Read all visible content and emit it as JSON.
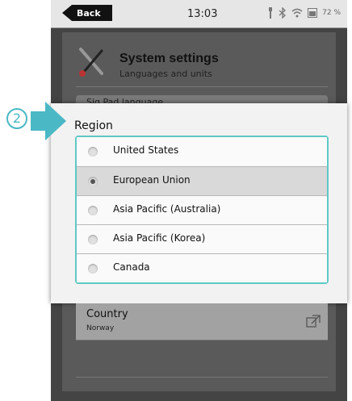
{
  "statusbar": {
    "back_label": "Back",
    "time": "13:03",
    "battery": "72 %",
    "icons": [
      "usb-icon",
      "bluetooth-icon",
      "wifi-icon",
      "battery-icon"
    ]
  },
  "header": {
    "title": "System settings",
    "subtitle": "Languages and units"
  },
  "behind_row_label": "Sig Pad language",
  "dialog": {
    "title": "Region",
    "options": [
      {
        "label": "United States",
        "selected": false
      },
      {
        "label": "European Union",
        "selected": true
      },
      {
        "label": "Asia Pacific (Australia)",
        "selected": false
      },
      {
        "label": "Asia Pacific (Korea)",
        "selected": false
      },
      {
        "label": "Canada",
        "selected": false
      }
    ]
  },
  "country": {
    "label": "Country",
    "value": "Norway"
  },
  "step_marker": "2",
  "colors": {
    "accent": "#5ec8c4",
    "step": "#4bb8c5"
  }
}
